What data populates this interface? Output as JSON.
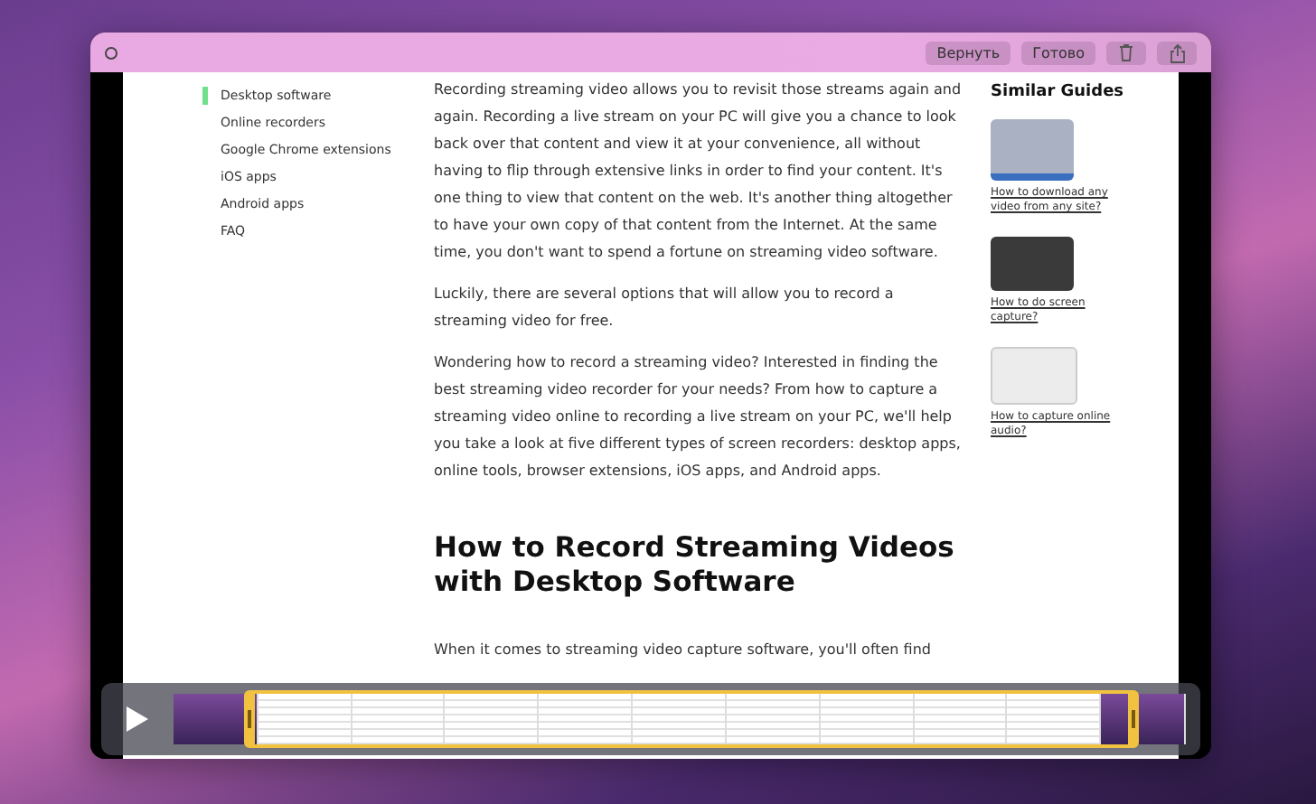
{
  "toolbar": {
    "buttons": [
      "Вернуть",
      "Готово"
    ]
  },
  "nav": {
    "items": [
      {
        "label": "Desktop software",
        "selected": true
      },
      {
        "label": "Online recorders",
        "selected": false
      },
      {
        "label": "Google Chrome extensions",
        "selected": false
      },
      {
        "label": "iOS apps",
        "selected": false
      },
      {
        "label": "Android apps",
        "selected": false
      },
      {
        "label": "FAQ",
        "selected": false
      }
    ]
  },
  "article": {
    "paragraphs": [
      "Recording streaming video allows you to revisit those streams again and again. Recording a live stream on your PC will give you a chance to look back over that content and view it at your convenience, all without having to flip through extensive links in order to find your content. It's one thing to view that content on the web. It's another thing altogether to have your own copy of that content from the Internet. At the same time, you don't want to spend a fortune on streaming video software.",
      "Luckily, there are several options that will allow you to record a streaming video for free.",
      "Wondering how to record a streaming video? Interested in finding the best streaming video recorder for your needs? From how to capture a streaming video online to recording a live stream on your PC, we'll help you take a look at five different types of screen recorders: desktop apps, online tools, browser extensions, iOS apps, and Android apps."
    ],
    "heading": "How to Record Streaming Videos with Desktop Software",
    "after_heading": "When it comes to streaming video capture software, you'll often find"
  },
  "similar_guides": {
    "title": "Similar Guides",
    "items": [
      {
        "link": "How to download any video from any site?"
      },
      {
        "link": "How to do screen capture?"
      },
      {
        "link": "How to capture online audio?"
      }
    ]
  }
}
